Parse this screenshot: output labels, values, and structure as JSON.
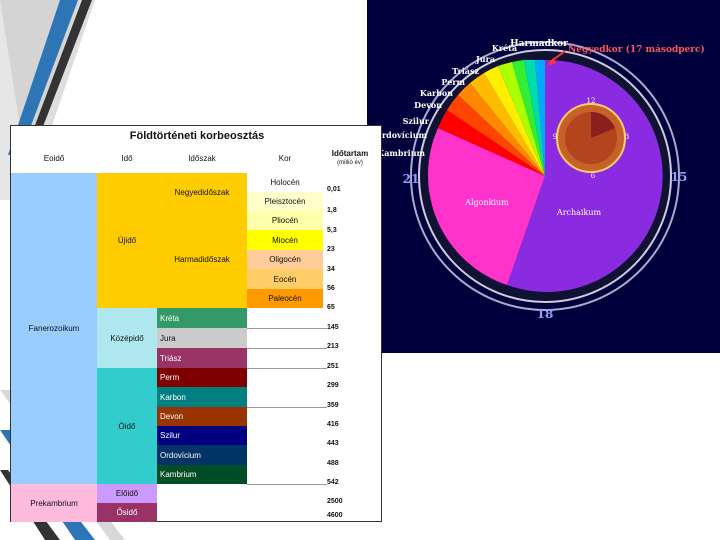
{
  "table": {
    "title": "Földtörténeti korbeosztás",
    "headers": {
      "eon": "Eoidő",
      "era": "Idő",
      "period": "Időszak",
      "epoch": "Kor",
      "duration": "Időtartam",
      "duration_unit": "(millió év)"
    },
    "eons": [
      {
        "label": "Fanerozoikum"
      },
      {
        "label": "Prekambrium"
      }
    ],
    "eras": [
      {
        "label": "Újidő"
      },
      {
        "label": "Középidő"
      },
      {
        "label": "Óidő"
      },
      {
        "label": "Előidő"
      },
      {
        "label": "Ősidő"
      }
    ],
    "periods": [
      {
        "label": "Negyedidőszak"
      },
      {
        "label": "Harmadidőszak"
      },
      {
        "label": "Kréta"
      },
      {
        "label": "Jura"
      },
      {
        "label": "Triász"
      },
      {
        "label": "Perm"
      },
      {
        "label": "Karbon"
      },
      {
        "label": "Devon"
      },
      {
        "label": "Szilur"
      },
      {
        "label": "Ordovícium"
      },
      {
        "label": "Kambrium"
      }
    ],
    "epochs": [
      {
        "label": "Holocén"
      },
      {
        "label": "Pleisztocén"
      },
      {
        "label": "Pliocén"
      },
      {
        "label": "Miocén"
      },
      {
        "label": "Oligocén"
      },
      {
        "label": "Eocén"
      },
      {
        "label": "Paleocén"
      }
    ],
    "durations": [
      "0,01",
      "1,8",
      "5,3",
      "23",
      "34",
      "56",
      "65",
      "145",
      "213",
      "251",
      "299",
      "359",
      "416",
      "443",
      "488",
      "542",
      "2500",
      "4600"
    ]
  },
  "clock": {
    "outer_labels": {
      "top": "Harmadkor",
      "left": "21",
      "right": "15",
      "bottom": "18"
    },
    "arrow_label": "Negyedkor (17 másodperc)",
    "period_labels": [
      "Kréta",
      "Jura",
      "Triász",
      "Perm",
      "Karbon",
      "Devon",
      "Szilur",
      "Ordovícium",
      "Kambrium"
    ],
    "segment_labels": {
      "algonkium": "Algonkium",
      "archaikum": "Archaikum"
    },
    "inner_clock": {
      "n12": "12",
      "n3": "3",
      "n6": "6",
      "n9": "9"
    }
  },
  "colors": {
    "ujido": "#ffcc00",
    "kozepido": "#aee8ee",
    "oido": "#33cccc",
    "fanerozoikum": "#99ccff",
    "prekambrium": "#ffbbdd",
    "elöido": "#cc99ff",
    "osido": "#993366",
    "archaikum": "#8a2be2",
    "algonkium": "#ff33cc",
    "clock_bg": "#00003c"
  }
}
